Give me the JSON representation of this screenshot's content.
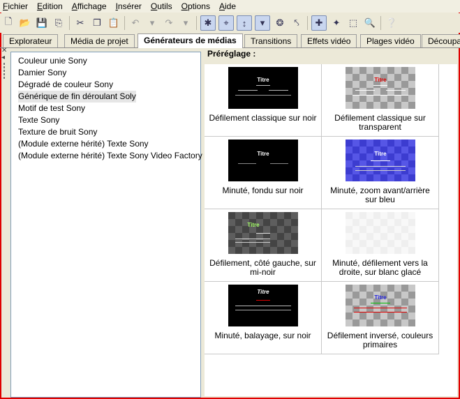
{
  "menubar": {
    "items": [
      {
        "u": "F",
        "rest": "ichier"
      },
      {
        "u": "E",
        "rest": "dition"
      },
      {
        "u": "A",
        "rest": "ffichage"
      },
      {
        "u": "I",
        "rest": "nsérer"
      },
      {
        "u": "O",
        "rest": "utils"
      },
      {
        "u": "O",
        "rest": "ptions"
      },
      {
        "u": "A",
        "rest": "ide"
      }
    ]
  },
  "tabs": [
    {
      "label": "Explorateur"
    },
    {
      "label": "Média de projet"
    },
    {
      "label": "Générateurs de médias"
    },
    {
      "label": "Transitions"
    },
    {
      "label": "Effets vidéo"
    },
    {
      "label": "Plages vidéo"
    },
    {
      "label": "Découpage"
    }
  ],
  "generators": [
    "Couleur unie Sony",
    "Damier Sony",
    "Dégradé de couleur Sony",
    "Générique de fin déroulant Soly",
    "Motif de test Sony",
    "Texte Sony",
    "Texture de bruit Sony",
    "(Module externe hérité) Texte Sony",
    "(Module externe hérité) Texte Sony Video Factory"
  ],
  "presets_heading": "Préréglage :",
  "presets": [
    {
      "label": "Défilement classique sur noir",
      "thumb_title": "Titre"
    },
    {
      "label": "Défilement classique sur transparent",
      "thumb_title": "Titre"
    },
    {
      "label": "Minuté, fondu sur noir",
      "thumb_title": "Titre"
    },
    {
      "label": "Minuté, zoom avant/arrière sur bleu",
      "thumb_title": "Titre"
    },
    {
      "label": "Défilement, côté gauche, sur mi-noir",
      "thumb_title": "Titre"
    },
    {
      "label": "Minuté, défilement vers la droite, sur blanc glacé",
      "thumb_title": ""
    },
    {
      "label": "Minuté, balayage, sur noir",
      "thumb_title": "Titre"
    },
    {
      "label": "Défilement inversé, couleurs primaires",
      "thumb_title": "Titre"
    }
  ],
  "colors": {
    "window_frame": "#e00000",
    "thumb_red_title": "#e00000",
    "thumb_blue_title": "#2020e0",
    "thumb_green_title": "#a6ff6a"
  }
}
